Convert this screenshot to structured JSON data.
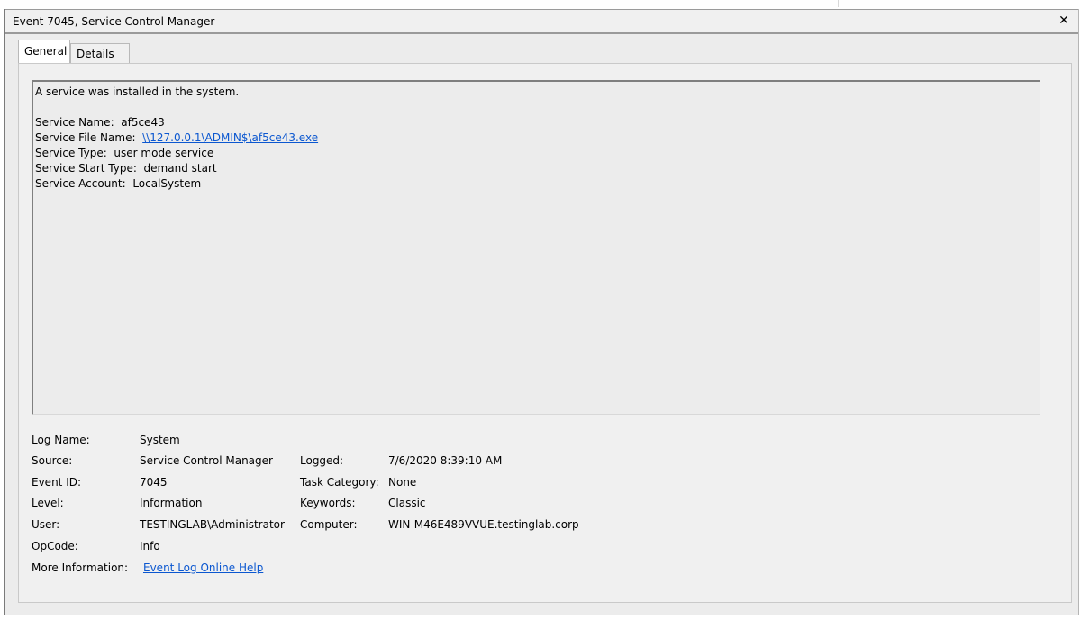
{
  "window": {
    "title": "Event 7045, Service Control Manager",
    "close_glyph": "✕"
  },
  "tabs": [
    {
      "label": "General",
      "active": true
    },
    {
      "label": "Details",
      "active": false
    }
  ],
  "message": {
    "summary": "A service was installed in the system.",
    "lines": [
      {
        "label": "Service Name:",
        "value": "af5ce43"
      },
      {
        "label": "Service File Name:",
        "value": "\\\\127.0.0.1\\ADMIN$\\af5ce43.exe"
      },
      {
        "label": "Service Type:",
        "value": "user mode service"
      },
      {
        "label": "Service Start Type:",
        "value": "demand start"
      },
      {
        "label": "Service Account:",
        "value": "LocalSystem"
      }
    ]
  },
  "properties": {
    "log_name": {
      "label": "Log Name:",
      "value": "System"
    },
    "source": {
      "label": "Source:",
      "value": "Service Control Manager"
    },
    "logged": {
      "label": "Logged:",
      "value": "7/6/2020 8:39:10 AM"
    },
    "event_id": {
      "label": "Event ID:",
      "value": "7045"
    },
    "task_category": {
      "label": "Task Category:",
      "value": "None"
    },
    "level": {
      "label": "Level:",
      "value": "Information"
    },
    "keywords": {
      "label": "Keywords:",
      "value": "Classic"
    },
    "user": {
      "label": "User:",
      "value": "TESTINGLAB\\Administrator"
    },
    "computer": {
      "label": "Computer:",
      "value": "WIN-M46E489VVUE.testinglab.corp"
    },
    "opcode": {
      "label": "OpCode:",
      "value": "Info"
    },
    "more_info": {
      "label": "More Information:",
      "value": "Event Log Online Help"
    }
  },
  "colors": {
    "link": "#0b57d0",
    "panel_bg": "#f0f0f0"
  }
}
